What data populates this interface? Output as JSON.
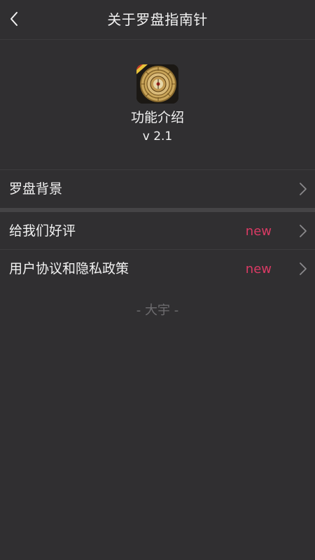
{
  "header": {
    "title": "关于罗盘指南针",
    "back_icon": "chevron-left-icon"
  },
  "app": {
    "icon": "compass-app-icon",
    "name": "功能介绍",
    "version": "v 2.1"
  },
  "menu": {
    "items": [
      {
        "label": "罗盘背景",
        "badge": "",
        "icon": "chevron-right-icon"
      },
      {
        "label": "给我们好评",
        "badge": "new",
        "icon": "chevron-right-icon"
      },
      {
        "label": "用户协议和隐私政策",
        "badge": "new",
        "icon": "chevron-right-icon"
      }
    ]
  },
  "footer": {
    "text": "- 大宇 -"
  },
  "colors": {
    "background": "#302f31",
    "text": "#f2f2f2",
    "badge": "#d93a64",
    "muted": "#6e6d70",
    "chevron": "#8a898c"
  }
}
